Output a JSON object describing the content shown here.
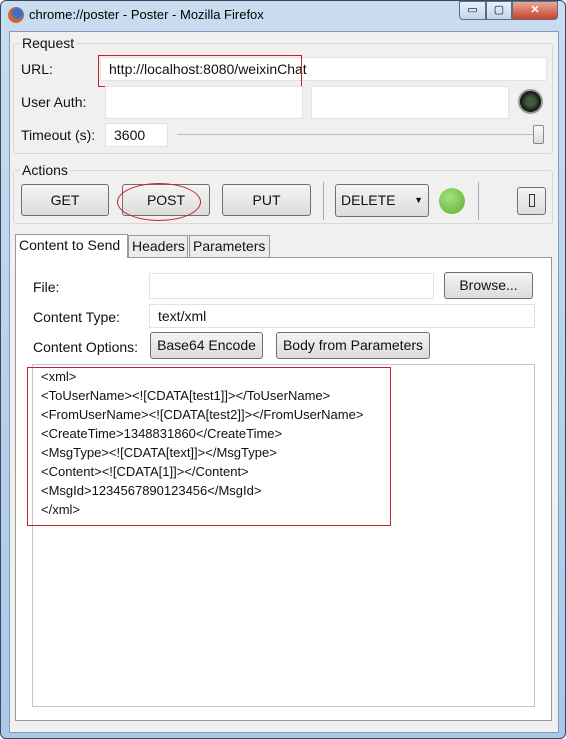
{
  "window": {
    "title": "chrome://poster - Poster - Mozilla Firefox",
    "minimize": "▭",
    "maximize": "▢",
    "close": "✕"
  },
  "request": {
    "group_label": "Request",
    "url_label": "URL:",
    "url_value": "http://localhost:8080/weixinChat",
    "user_auth_label": "User Auth:",
    "user_value": "",
    "password_value": "",
    "timeout_label": "Timeout (s):",
    "timeout_value": "3600",
    "timeout_slider_percent": 100
  },
  "actions": {
    "group_label": "Actions",
    "get": "GET",
    "post": "POST",
    "put": "PUT",
    "method_select": "DELETE",
    "status_color": "#6cc04a"
  },
  "tabs": [
    {
      "label": "Content to Send",
      "active": true
    },
    {
      "label": "Headers"
    },
    {
      "label": "Parameters"
    }
  ],
  "content": {
    "file_label": "File:",
    "file_value": "",
    "browse": "Browse...",
    "content_type_label": "Content Type:",
    "content_type_value": "text/xml",
    "options_label": "Content Options:",
    "base64": "Base64 Encode",
    "body_from_params": "Body from Parameters",
    "body_lines": [
      "<xml>",
      "<ToUserName><![CDATA[test1]]></ToUserName>",
      "<FromUserName><![CDATA[test2]]></FromUserName>",
      "<CreateTime>1348831860</CreateTime>",
      "<MsgType><![CDATA[text]]></MsgType>",
      "<Content><![CDATA[1]]></Content>",
      "<MsgId>1234567890123456</MsgId>",
      "</xml>"
    ]
  },
  "annotation_color": "#c8202c"
}
